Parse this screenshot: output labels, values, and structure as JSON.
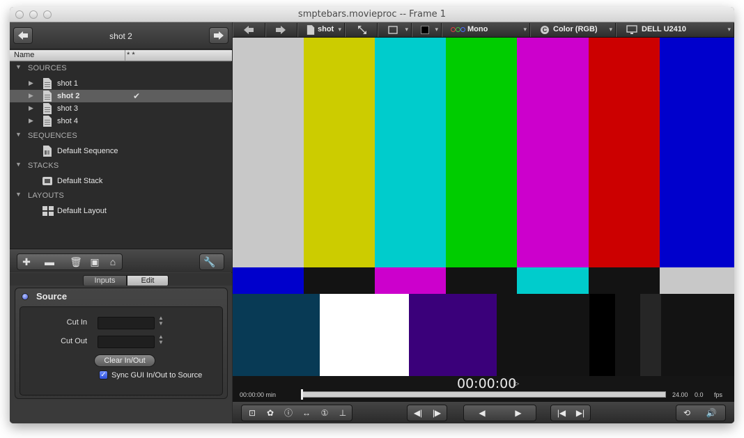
{
  "window": {
    "title": "smptebars.movieproc -- Frame 1"
  },
  "left": {
    "nav": {
      "title": "shot 2"
    },
    "columns": {
      "name": "Name",
      "flags": "*  *"
    },
    "tree": {
      "sources": {
        "label": "SOURCES",
        "items": [
          "shot 1",
          "shot 2",
          "shot 3",
          "shot 4"
        ],
        "selected": "shot 2"
      },
      "sequences": {
        "label": "SEQUENCES",
        "items": [
          "Default Sequence"
        ]
      },
      "stacks": {
        "label": "STACKS",
        "items": [
          "Default Stack"
        ]
      },
      "layouts": {
        "label": "LAYOUTS",
        "items": [
          "Default Layout"
        ]
      }
    },
    "tabs": {
      "inputs": "Inputs",
      "edit": "Edit",
      "active": "Edit"
    },
    "source": {
      "title": "Source",
      "cut_in_label": "Cut In",
      "cut_in_value": "",
      "cut_out_label": "Cut Out",
      "cut_out_value": "",
      "clear_label": "Clear In/Out",
      "sync_label": "Sync GUI In/Out to Source",
      "sync_checked": true
    }
  },
  "toolbar": {
    "source": "shot",
    "channel": "Mono",
    "color": "Color (RGB)",
    "display": "DELL U2410"
  },
  "timeline": {
    "timecode": "00:00:00",
    "start": "00:00:00 min",
    "fps_value": "24.00",
    "fps_actual": "0.0",
    "fps_label": "fps"
  },
  "colors": {
    "top": [
      "#c8c8c8",
      "#cccc00",
      "#00cccc",
      "#00cc00",
      "#cc00cc",
      "#cc0000",
      "#0000cc"
    ],
    "mid": [
      "#0000cc",
      "#131313",
      "#cc00cc",
      "#131313",
      "#00cccc",
      "#131313",
      "#c8c8c8"
    ],
    "bottom": [
      "#083a55",
      "#ffffff",
      "#3a007a",
      "#131313",
      "#000000",
      "#131313",
      "#262626",
      "#131313"
    ]
  }
}
